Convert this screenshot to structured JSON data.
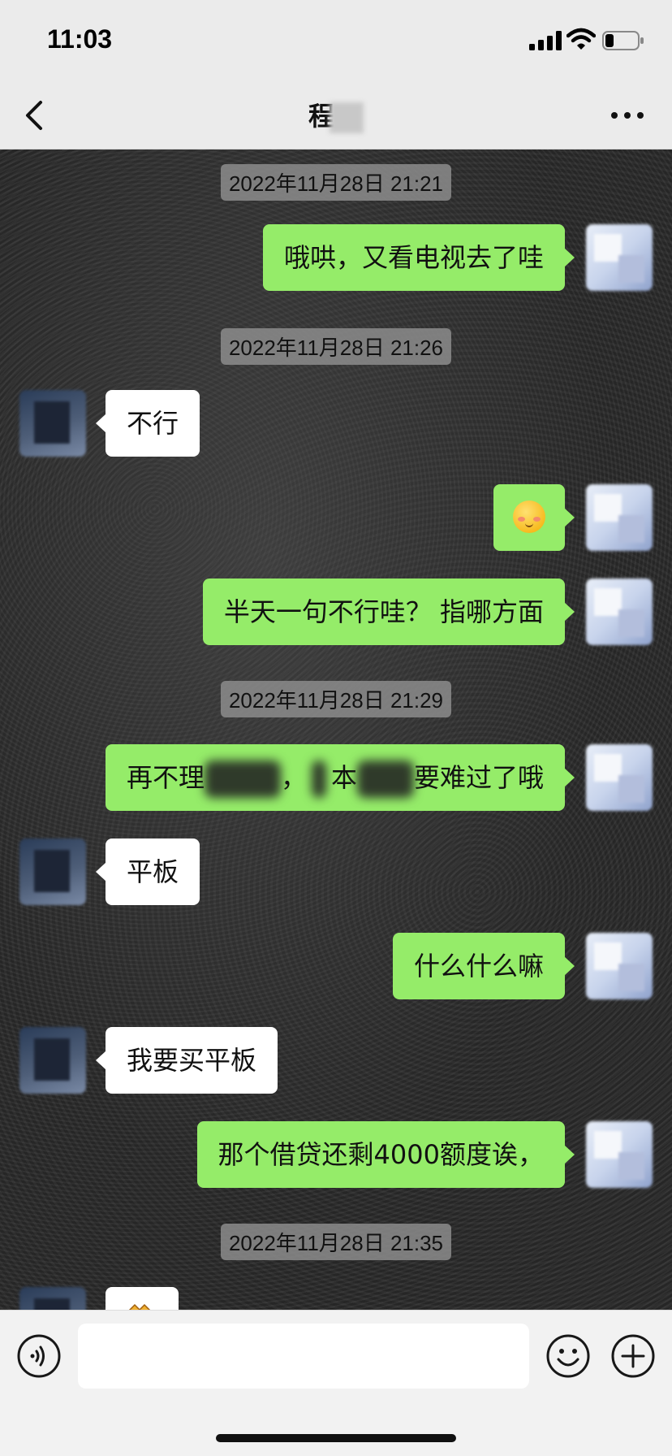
{
  "status_bar": {
    "time": "11:03"
  },
  "nav": {
    "title": "程"
  },
  "input": {
    "placeholder": ""
  },
  "messages": [
    {
      "type": "timestamp",
      "text": "2022年11月28日 21:21"
    },
    {
      "type": "sent",
      "text": "哦哄，又看电视去了哇"
    },
    {
      "type": "timestamp",
      "text": "2022年11月28日 21:26"
    },
    {
      "type": "received",
      "text": "不行"
    },
    {
      "type": "sent",
      "emoji": "smiling-face-blushing-icon"
    },
    {
      "type": "sent",
      "text": "半天一句不行哇？ 指哪方面"
    },
    {
      "type": "timestamp",
      "text": "2022年11月28日 21:29"
    },
    {
      "type": "sent",
      "parts": [
        "再不理",
        "，",
        "本",
        "要难过了哦"
      ]
    },
    {
      "type": "received",
      "text": "平板"
    },
    {
      "type": "sent",
      "text": "什么什么嘛"
    },
    {
      "type": "received",
      "text": "我要买平板"
    },
    {
      "type": "sent",
      "text": "那个借贷还剩4000额度诶，"
    },
    {
      "type": "timestamp",
      "text": "2022年11月28日 21:35"
    },
    {
      "type": "received",
      "emoji": "sticker-icon"
    }
  ],
  "colors": {
    "sent_bubble": "#95ec69",
    "received_bubble": "#ffffff",
    "bar_bg": "#ebebeb"
  }
}
